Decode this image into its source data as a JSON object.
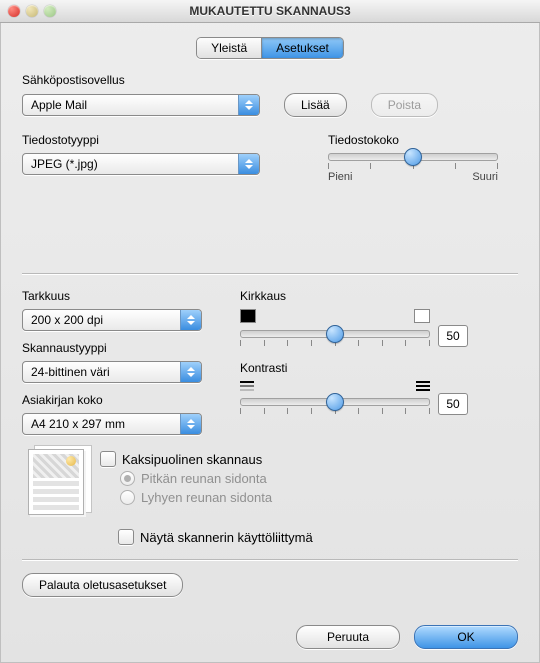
{
  "window": {
    "title": "MUKAUTETTU SKANNAUS3"
  },
  "tabs": {
    "general": "Yleistä",
    "settings": "Asetukset"
  },
  "email": {
    "label": "Sähköpostisovellus",
    "app": "Apple Mail",
    "add": "Lisää",
    "remove": "Poista"
  },
  "filetype": {
    "label": "Tiedostotyyppi",
    "value": "JPEG (*.jpg)"
  },
  "filesize": {
    "label": "Tiedostokoko",
    "min": "Pieni",
    "max": "Suuri"
  },
  "resolution": {
    "label": "Tarkkuus",
    "value": "200 x 200 dpi"
  },
  "scantype": {
    "label": "Skannaustyyppi",
    "value": "24-bittinen väri"
  },
  "docsize": {
    "label": "Asiakirjan koko",
    "value": "A4 210 x 297 mm"
  },
  "brightness": {
    "label": "Kirkkaus",
    "value": "50"
  },
  "contrast": {
    "label": "Kontrasti",
    "value": "50"
  },
  "duplex": {
    "label": "Kaksipuolinen skannaus",
    "long_edge": "Pitkän reunan sidonta",
    "short_edge": "Lyhyen reunan sidonta"
  },
  "show_ui": {
    "label": "Näytä skannerin käyttöliittymä"
  },
  "restore": "Palauta oletusasetukset",
  "cancel": "Peruuta",
  "ok": "OK"
}
